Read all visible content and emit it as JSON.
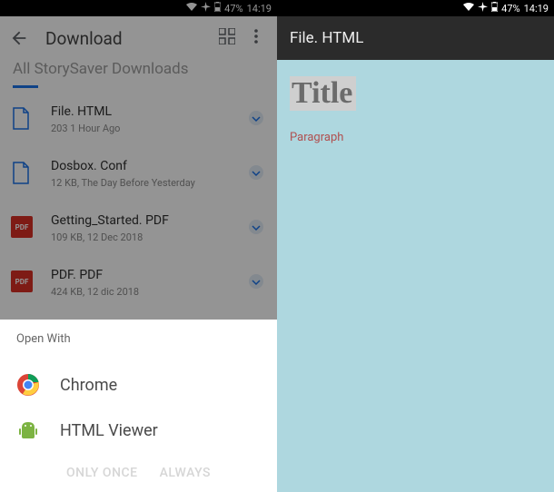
{
  "status": {
    "battery": "47%",
    "time": "14:19"
  },
  "left": {
    "app_title": "Download",
    "section_label": "All StorySaver Downloads",
    "files": [
      {
        "name": "File. HTML",
        "meta": "203 1 Hour Ago",
        "icon": "doc"
      },
      {
        "name": "Dosbox. Conf",
        "meta": "12 KB, The Day Before Yesterday",
        "icon": "doc"
      },
      {
        "name": "Getting_Started. PDF",
        "meta": "109 KB, 12 Dec 2018",
        "icon": "pdf"
      },
      {
        "name": "PDF. PDF",
        "meta": "424 KB, 12 dic 2018",
        "icon": "pdf"
      }
    ],
    "sheet": {
      "title": "Open With",
      "options": [
        {
          "label": "Chrome",
          "icon": "chrome"
        },
        {
          "label": "HTML Viewer",
          "icon": "android"
        }
      ],
      "action_once": "ONLY ONCE",
      "action_always": "ALWAYS"
    }
  },
  "right": {
    "titlebar": "File. HTML",
    "doc_title": "Title",
    "doc_paragraph": "Paragraph"
  }
}
